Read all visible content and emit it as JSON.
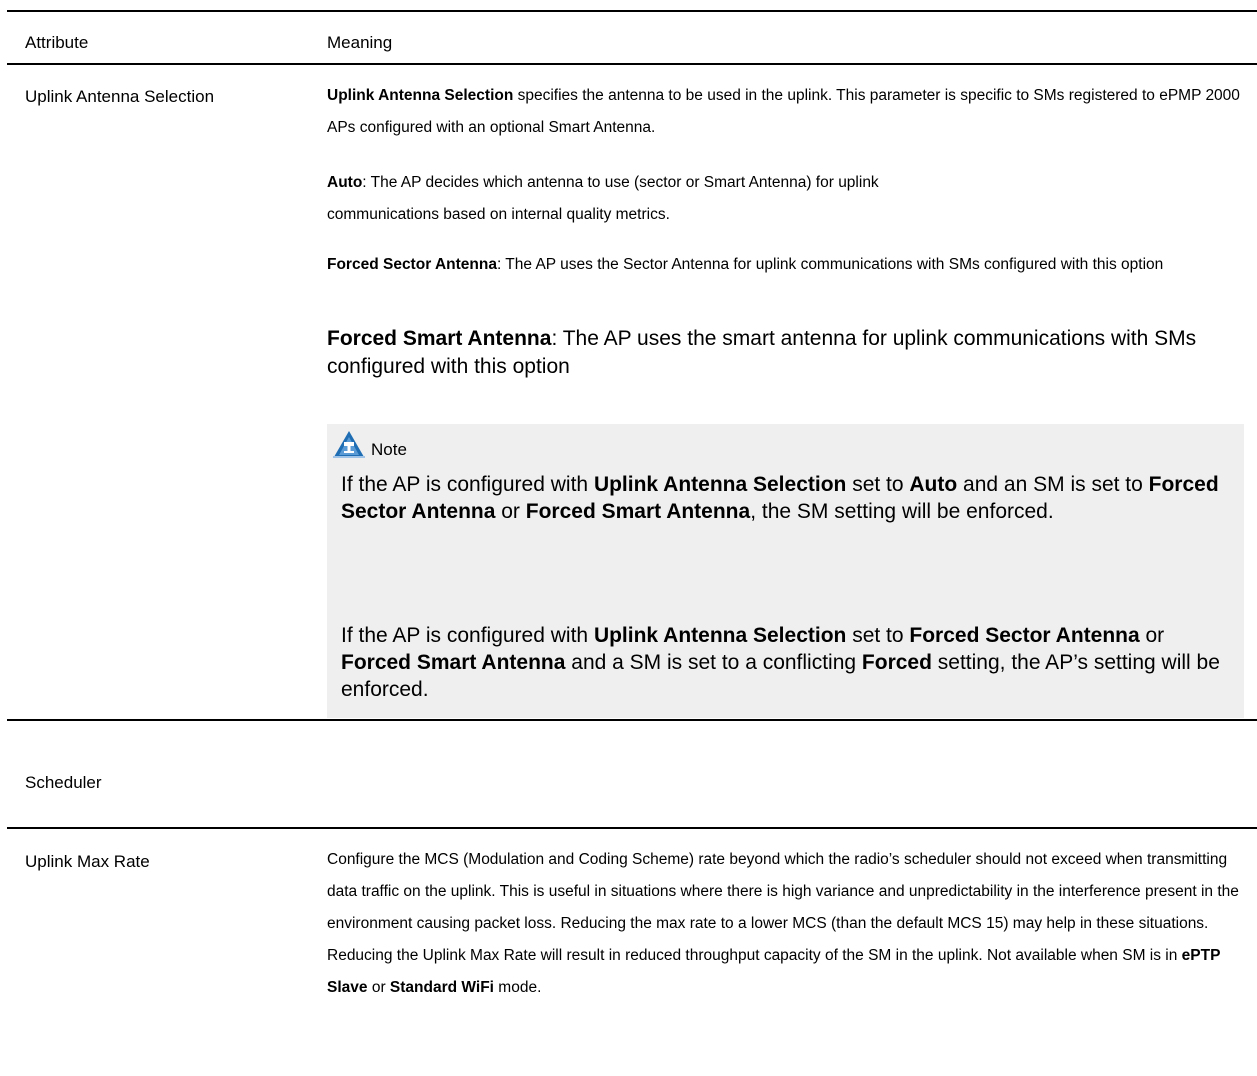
{
  "table": {
    "headers": {
      "attribute": "Attribute",
      "meaning": "Meaning"
    },
    "row1": {
      "attribute": "Uplink Antenna Selection",
      "p1": {
        "bold": "Uplink Antenna Selection",
        "rest": " specifies the antenna to be used in the uplink.  This parameter is specific to SMs registered to ePMP 2000 APs configured with an optional Smart Antenna."
      },
      "p2": {
        "bold": "Auto",
        "rest": ":  The AP decides which antenna to use (sector or Smart Antenna) for uplink communications based on internal quality metrics."
      },
      "p3": {
        "bold": "Forced Sector Antenna",
        "rest": ":  The AP uses the Sector Antenna for uplink communications with SMs configured with this option"
      },
      "p4": {
        "bold": "Forced Smart Antenna",
        "rest": ":  The AP uses the smart antenna for uplink communications with SMs configured with this option"
      },
      "note": {
        "label": "Note",
        "icon": "note-icon",
        "n1": {
          "t1": "If the AP is configured with ",
          "b1": "Uplink Antenna Selection",
          "t2": " set to ",
          "b2": "Auto",
          "t3": " and an SM is set to ",
          "b3": "Forced Sector Antenna",
          "t4": " or ",
          "b4": "Forced Smart Antenna",
          "t5": ", the SM setting will be enforced."
        },
        "n2": {
          "t1": "If the AP is configured with ",
          "b1": "Uplink Antenna Selection",
          "t2": " set to ",
          "b2": "Forced Sector Antenna",
          "t3": " or ",
          "b3": "Forced Smart Antenna",
          "t4": " and a SM is set to a conflicting ",
          "b4": "Forced",
          "t5": " setting, the AP’s setting will be enforced."
        }
      }
    },
    "section": {
      "label": "Scheduler"
    },
    "row2": {
      "attribute": "Uplink Max Rate",
      "t1": "Configure the MCS (Modulation and Coding Scheme) rate beyond which the radio’s scheduler should not exceed when transmitting data traffic on the uplink. This is useful in situations where there is high variance and unpredictability in the interference present in the environment causing packet loss. Reducing the max rate to a lower MCS (than the default MCS 15) may help in these situations. Reducing the Uplink Max Rate will result in reduced throughput capacity of the SM in the uplink. Not available when SM is in ",
      "b1": "ePTP Slave",
      "t2": " or ",
      "b2": "Standard WiFi",
      "t3": " mode."
    }
  },
  "colors": {
    "note_bg": "#efefef",
    "icon_blue": "#1f6db3"
  }
}
